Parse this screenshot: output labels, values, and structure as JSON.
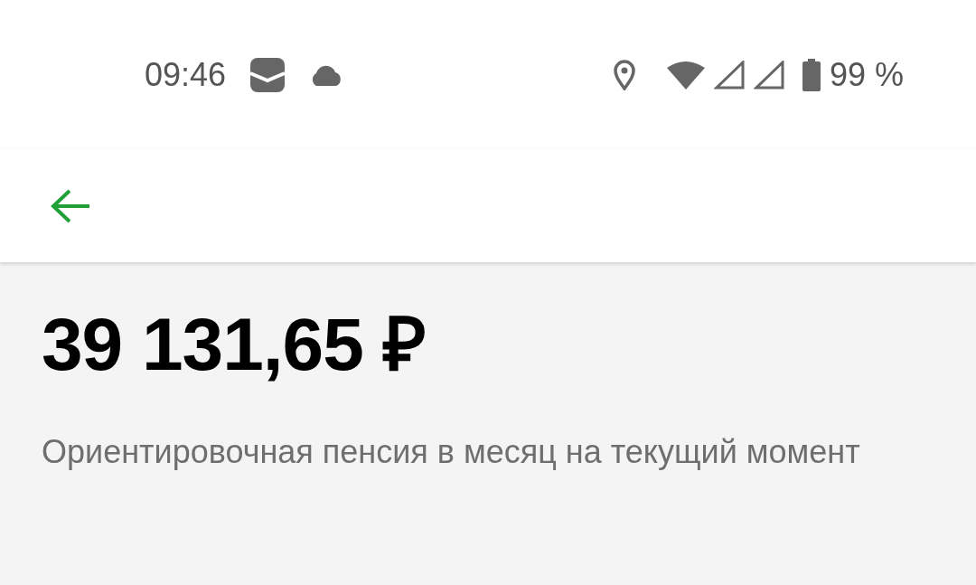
{
  "status_bar": {
    "time": "09:46",
    "battery": "99 %"
  },
  "pension": {
    "amount": "39 131,65 ₽",
    "description": "Ориентировочная пенсия в месяц на текущий момент"
  }
}
